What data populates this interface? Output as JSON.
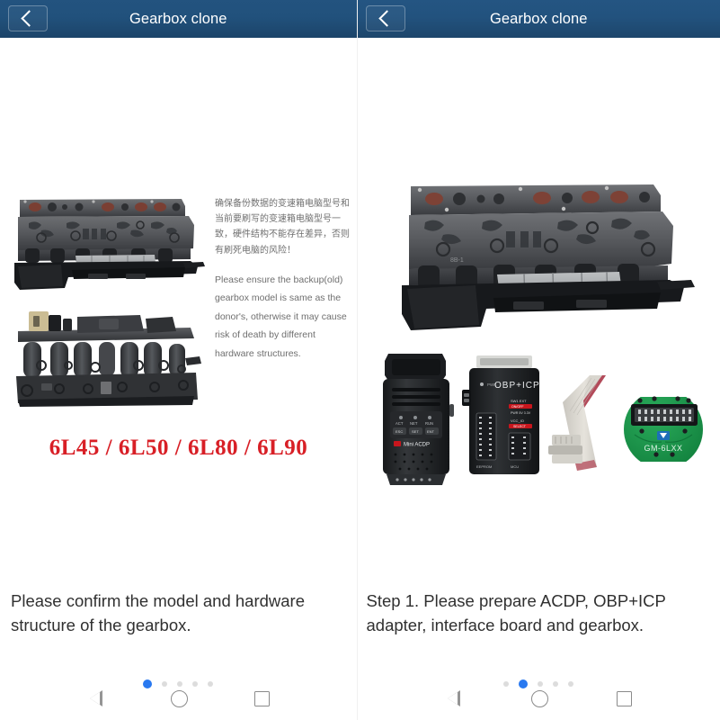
{
  "panels": [
    {
      "header": {
        "title": "Gearbox clone",
        "back_icon": "back-chevron-icon"
      },
      "notice_cn": "确保备份数据的变速箱电脑型号和当前要刷写的变速箱电脑型号一致，硬件结构不能存在差异，否则有刷死电脑的风险！",
      "notice_en": "Please ensure the backup(old) gearbox model is same as the donor's, otherwise it may cause risk of death by different hardware structures.",
      "model_line": "6L45 / 6L50 / 6L80 / 6L90",
      "caption": "Please confirm the model and hardware structure of the gearbox.",
      "dots": {
        "count": 5,
        "active_index": 0
      },
      "images": [
        {
          "name": "gearbox-valve-body-photo",
          "alt": "GM 6L transmission valve body side view"
        },
        {
          "name": "gearbox-solenoid-pack-photo",
          "alt": "GM 6L transmission solenoid pack top view"
        }
      ]
    },
    {
      "header": {
        "title": "Gearbox clone",
        "back_icon": "back-chevron-icon"
      },
      "caption": "Step 1. Please prepare ACDP, OBP+ICP adapter, interface board and gearbox.",
      "dots": {
        "count": 5,
        "active_index": 1
      },
      "images": [
        {
          "name": "gearbox-valve-body-photo",
          "alt": "GM 6L transmission valve body side view"
        }
      ],
      "devices": [
        {
          "name": "mini-acdp-device",
          "label": "Mini ACDP"
        },
        {
          "name": "obp-icp-adapter-device",
          "label": "OBP+ICP"
        },
        {
          "name": "ribbon-cable",
          "label": "Ribbon cable"
        },
        {
          "name": "interface-board",
          "label": "GM-6LXX"
        }
      ]
    }
  ],
  "navbar": {
    "back_label": "Back",
    "home_label": "Home",
    "recents_label": "Recents"
  },
  "colors": {
    "appbar": "#21527c",
    "accent_dot": "#2979f0",
    "model_red": "#d81f26",
    "caption_text": "#303030",
    "body_text": "#6f6f6f",
    "board_green": "#1a9a4b"
  }
}
